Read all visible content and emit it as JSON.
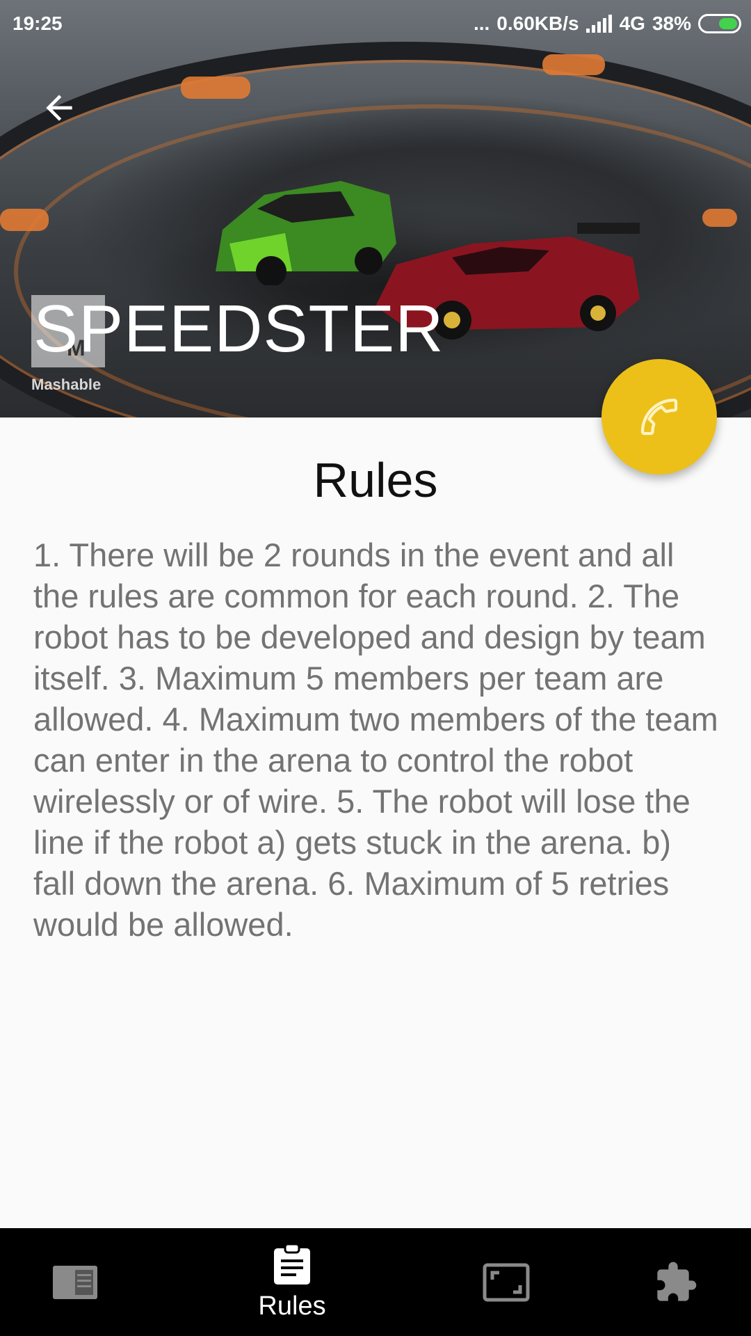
{
  "status_bar": {
    "time": "19:25",
    "dots": "...",
    "network_speed": "0.60KB/s",
    "network_type": "4G",
    "battery": "38%"
  },
  "hero": {
    "title": "SPEEDSTER",
    "watermark_letter": "M",
    "watermark_text": "Mashable"
  },
  "content": {
    "section_title": "Rules",
    "rules_text": "1. There will be 2 rounds in the event and all the rules are common for each round. 2. The robot has to be developed and design by team itself. 3. Maximum 5 members per team are allowed. 4. Maximum two members of the team can enter in the arena to control the robot wirelessly or of wire. 5. The robot will lose the line if the robot a) gets stuck in the arena. b) fall down the arena. 6. Maximum of 5 retries would be allowed."
  },
  "bottom_nav": {
    "items": [
      {
        "icon": "article-icon",
        "label": ""
      },
      {
        "icon": "clipboard-icon",
        "label": "Rules"
      },
      {
        "icon": "fullscreen-icon",
        "label": ""
      },
      {
        "icon": "puzzle-icon",
        "label": ""
      }
    ]
  },
  "colors": {
    "fab": "#ecc019",
    "nav_background": "#000000",
    "rules_text": "#737373"
  }
}
